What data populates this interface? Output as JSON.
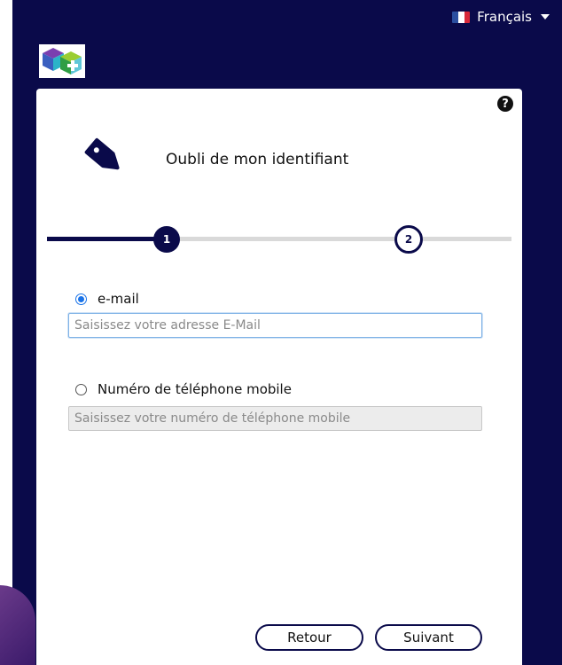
{
  "language": {
    "label": "Français",
    "flag_colors": [
      "#2b4fa0",
      "#ffffff",
      "#d8283a"
    ]
  },
  "card": {
    "title": "Oubli de mon identifiant",
    "help_symbol": "?",
    "icon": "tag-icon"
  },
  "stepper": {
    "steps": [
      "1",
      "2"
    ],
    "active_step": 1
  },
  "options": {
    "email": {
      "label": "e-mail",
      "selected": true,
      "placeholder": "Saisissez votre adresse E-Mail",
      "value": ""
    },
    "phone": {
      "label": "Numéro de téléphone mobile",
      "selected": false,
      "placeholder": "Saisissez votre numéro de téléphone mobile",
      "value": ""
    }
  },
  "buttons": {
    "back": "Retour",
    "next": "Suivant"
  },
  "colors": {
    "background": "#0a0a4a",
    "accent": "#0a0a4a",
    "radio": "#1a73e8"
  }
}
